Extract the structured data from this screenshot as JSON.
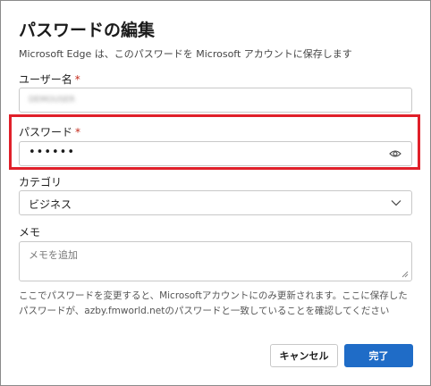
{
  "dialog": {
    "title": "パスワードの編集",
    "subtitle": "Microsoft Edge は、このパスワードを Microsoft アカウントに保存します"
  },
  "username": {
    "label": "ユーザー名",
    "required_mark": "*",
    "value": "DEMOUSER"
  },
  "password": {
    "label": "パスワード",
    "required_mark": "*",
    "value": "••••••",
    "highlight_color": "#e0202a"
  },
  "category": {
    "label": "カテゴリ",
    "selected": "ビジネス"
  },
  "memo": {
    "label": "メモ",
    "placeholder": "メモを追加"
  },
  "note": "ここでパスワードを変更すると、Microsoftアカウントにのみ更新されます。ここに保存したパスワードが、azby.fmworld.netのパスワードと一致していることを確認してください",
  "buttons": {
    "cancel": "キャンセル",
    "done": "完了"
  },
  "colors": {
    "accent": "#1f6cc7",
    "required": "#c42b1c"
  },
  "icons": {
    "password_reveal": "eye-icon",
    "dropdown": "chevron-down-icon",
    "resize": "resize-handle-icon"
  }
}
